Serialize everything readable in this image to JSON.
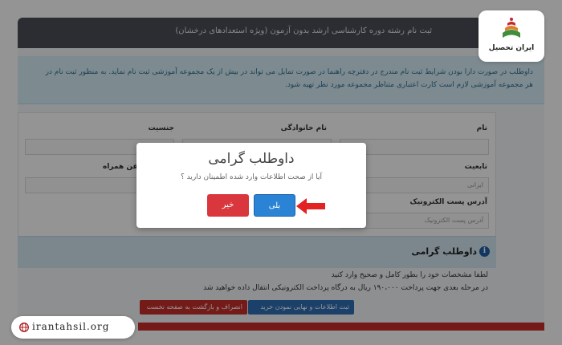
{
  "header": {
    "title": "ثبت نام رشته دوره کارشناسی ارشد بدون آزمون (ویژه استعدادهای درخشان)"
  },
  "info": {
    "lines": [
      "داوطلب در صورت دارا بودن شرایط ثبت نام مندرج در دفترچه راهنما در صورت تمایل می تواند در بیش از یک مجموعه آموزشی ثبت نام نماید. به منظور ثبت نام در",
      "هر مجموعه آموزشی لازم است کارت اعتباری متناظر مجموعه مورد نظر تهیه شود."
    ]
  },
  "form": {
    "name_label": "نام",
    "family_label": "نام خانوادگی",
    "gender_label": "جنسیت",
    "nationality_label": "تابعیت",
    "nationality_value": "ایرانی",
    "mobile_label": "تلفن همراه",
    "email_label": "آدرس پست الکترونیک",
    "email_placeholder": "آدرس پست الکترونیک"
  },
  "section": {
    "title": "داوطلب گرامی",
    "notes": [
      "لطفا مشخصات خود را بطور کامل و صحیح وارد کنید",
      "در مرحله بعدی جهت پرداخت ۱۹۰،۰۰۰ ریال به درگاه پرداخت الکترونیکی انتقال داده خواهید شد"
    ]
  },
  "actions": {
    "submit_label": "ثبت اطلاعات و نهایی نمودن خرید",
    "cancel_label": "انصراف و بازگشت به صفحه نخست"
  },
  "modal": {
    "title": "داوطلب گرامی",
    "message": "آیا از صحت اطلاعات وارد شده اطمینان دارید ؟",
    "yes_label": "بلی",
    "no_label": "خیر"
  },
  "brand": {
    "logo_text": "ایران تحصیل",
    "site": "irantahsil.org"
  },
  "colors": {
    "accent_blue": "#2a83d4",
    "danger_red": "#d9363e",
    "arrow_red": "#e32222"
  }
}
